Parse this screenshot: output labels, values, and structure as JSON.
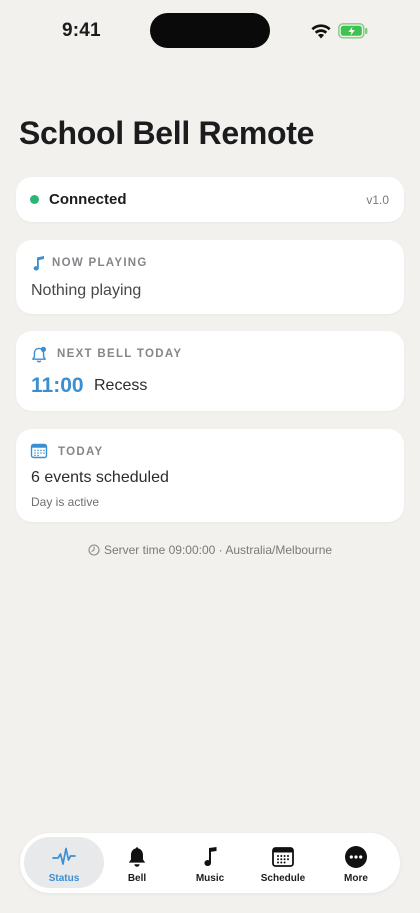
{
  "status_bar": {
    "time": "9:41"
  },
  "page": {
    "title": "School Bell Remote"
  },
  "connection": {
    "status": "Connected",
    "version": "v1.0",
    "status_color": "#2bb673"
  },
  "now_playing": {
    "heading": "NOW PLAYING",
    "text": "Nothing playing",
    "icon": "music-note-icon"
  },
  "next_bell": {
    "heading": "NEXT BELL TODAY",
    "time": "11:00",
    "name": "Recess",
    "icon": "bell-icon",
    "accent": "#3b8fd1"
  },
  "today": {
    "heading": "TODAY",
    "count_text": "6 events scheduled",
    "sub_text": "Day is active",
    "icon": "calendar-icon"
  },
  "server": {
    "text": "Server time 09:00:00  · Australia/Melbourne",
    "icon": "clock-icon"
  },
  "tabbar": {
    "tabs": [
      {
        "label": "Status",
        "icon": "pulse-icon",
        "active": true
      },
      {
        "label": "Bell",
        "icon": "bell-icon",
        "active": false
      },
      {
        "label": "Music",
        "icon": "music-note-icon",
        "active": false
      },
      {
        "label": "Schedule",
        "icon": "calendar-icon",
        "active": false
      },
      {
        "label": "More",
        "icon": "more-icon",
        "active": false
      }
    ]
  }
}
